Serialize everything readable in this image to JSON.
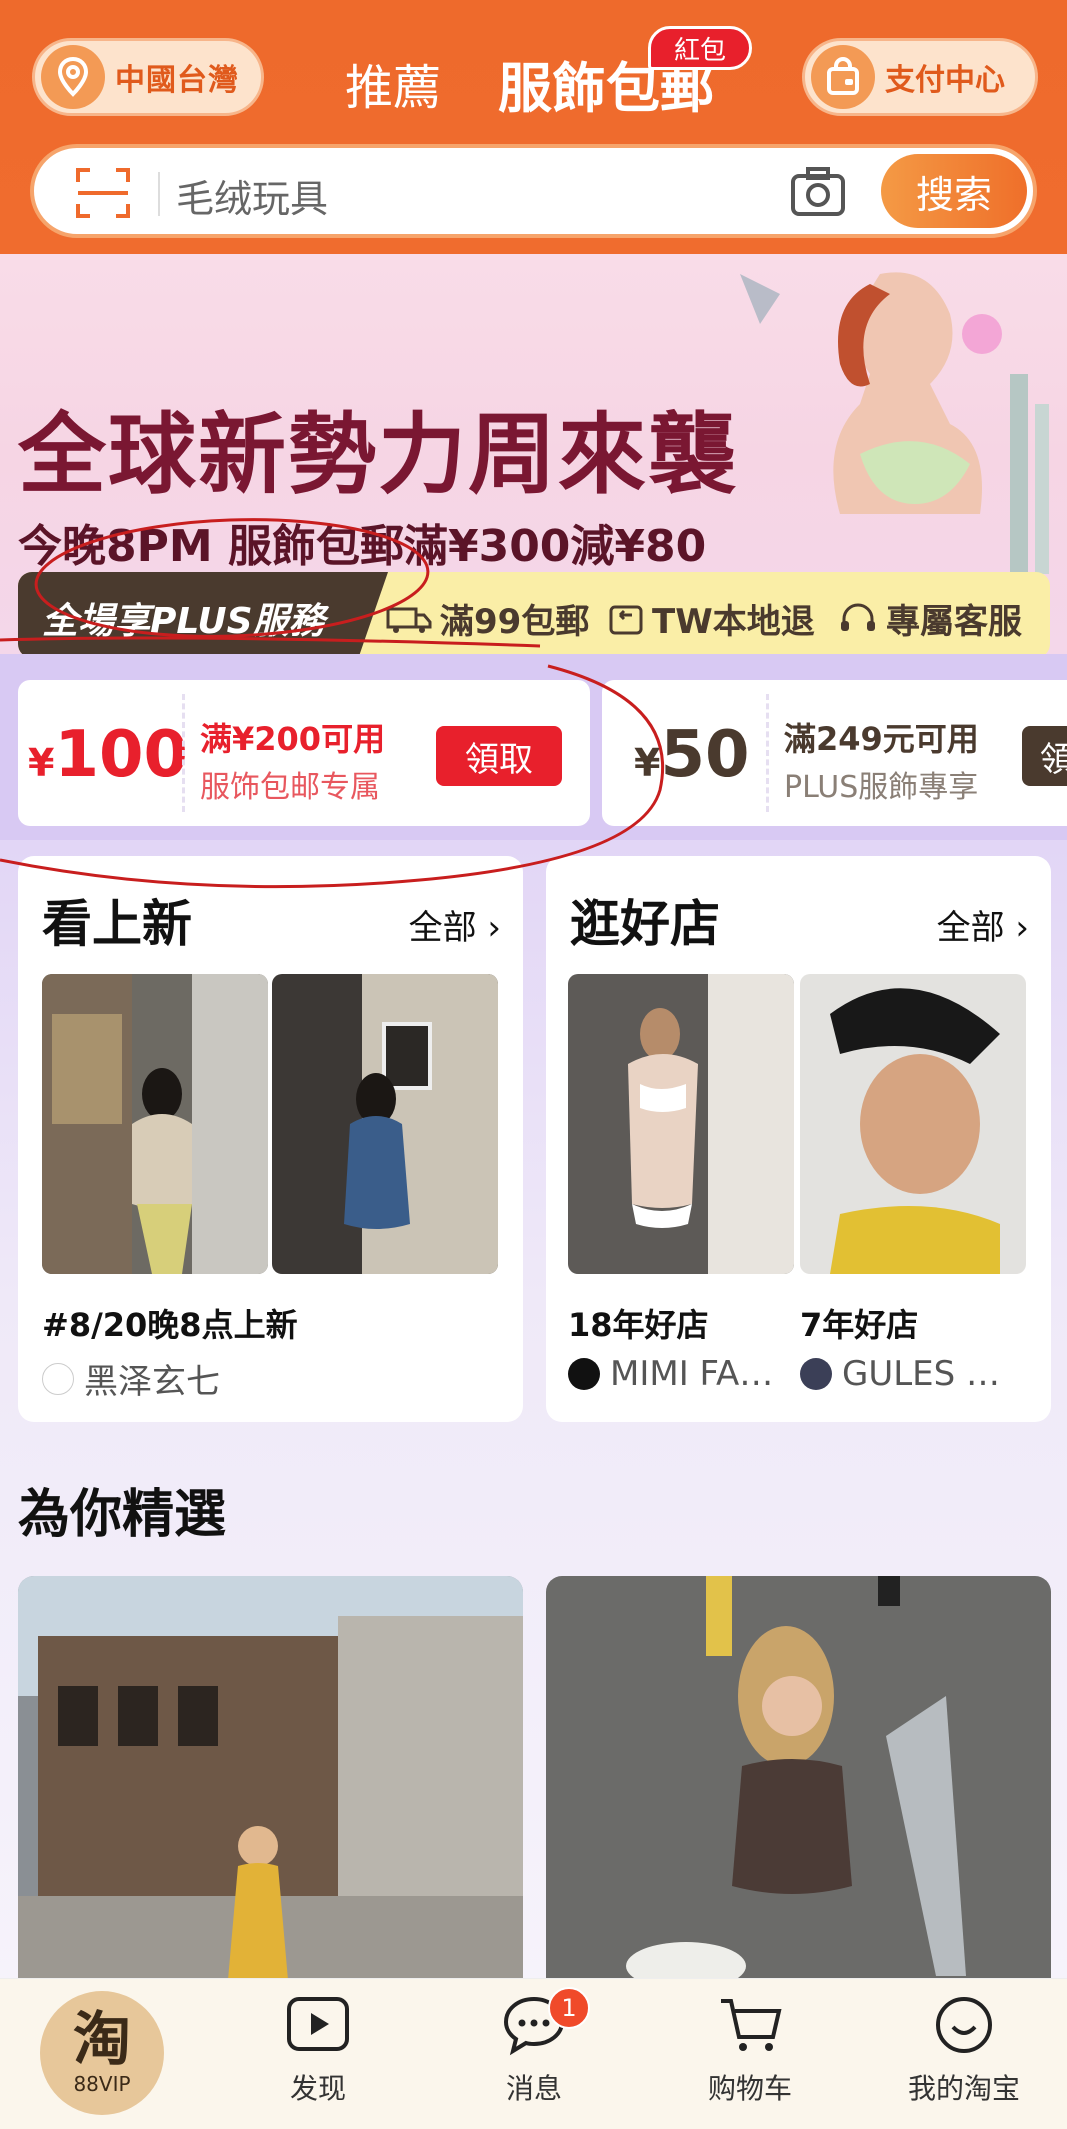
{
  "header": {
    "location_label": "中國台灣",
    "tabs": [
      {
        "label": "推薦"
      },
      {
        "label": "服飾包郵"
      }
    ],
    "tab_badge": "紅包",
    "pay_label": "支付中心",
    "search": {
      "placeholder": "毛绒玩具",
      "button_label": "搜索"
    }
  },
  "banner": {
    "title": "全球新勢力周來襲",
    "subtitle": "今晚8PM  服飾包郵滿¥300減¥80",
    "plus": {
      "label": "全場享PLUS服務",
      "items": [
        "滿99包郵",
        "TW本地退",
        "專屬客服"
      ]
    }
  },
  "coupons": [
    {
      "currency": "¥",
      "amount": "100",
      "condition": "满¥200可用",
      "note": "服饰包邮专属",
      "button": "領取"
    },
    {
      "currency": "¥",
      "amount": "50",
      "condition": "滿249元可用",
      "note": "PLUS服飾專享",
      "button": "領"
    }
  ],
  "cards": {
    "new": {
      "title": "看上新",
      "all_label": "全部 ›",
      "caption": "#8/20晚8点上新",
      "shop_name": "黑泽玄七"
    },
    "shops": {
      "title": "逛好店",
      "all_label": "全部 ›",
      "items": [
        {
          "caption": "18年好店",
          "shop_name": "MIMI FA…"
        },
        {
          "caption": "7年好店",
          "shop_name": "GULES …"
        }
      ]
    }
  },
  "picks": {
    "title": "為你精選"
  },
  "nav": {
    "vip_char": "淘",
    "vip_label": "88VIP",
    "items": [
      {
        "label": "发现",
        "icon": "play-icon"
      },
      {
        "label": "消息",
        "icon": "chat-icon",
        "badge": "1"
      },
      {
        "label": "购物车",
        "icon": "cart-icon"
      },
      {
        "label": "我的淘宝",
        "icon": "smile-icon"
      }
    ]
  },
  "colors": {
    "header_orange": "#ee6a2c",
    "coupon_red": "#e8202c",
    "annotation_red": "#c81e1e",
    "coupon_bg": "#d8c9f3"
  }
}
